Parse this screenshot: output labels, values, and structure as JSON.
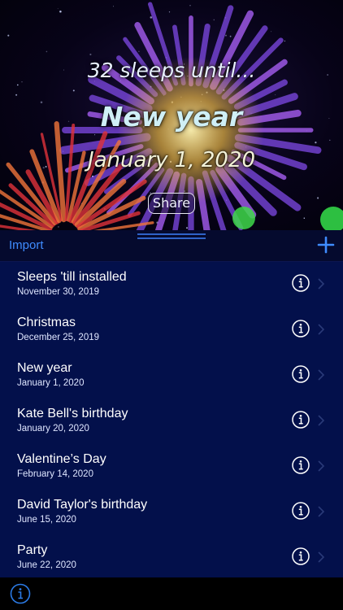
{
  "hero": {
    "countdown": "32 sleeps until...",
    "event_title": "New year",
    "event_date": "January 1, 2020",
    "share_label": "Share"
  },
  "toolbar": {
    "import_label": "Import",
    "add_icon": "plus-icon"
  },
  "events": [
    {
      "title": "Sleeps 'till installed",
      "date": "November 30, 2019"
    },
    {
      "title": "Christmas",
      "date": "December 25, 2019"
    },
    {
      "title": "New year",
      "date": "January 1, 2020"
    },
    {
      "title": "Kate Bell's birthday",
      "date": "January 20, 2020"
    },
    {
      "title": "Valentine’s Day",
      "date": "February 14, 2020"
    },
    {
      "title": "David Taylor's birthday",
      "date": "June 15, 2020"
    },
    {
      "title": "Party",
      "date": "June 22, 2020"
    }
  ],
  "bottom": {
    "info_icon": "info-icon"
  },
  "colors": {
    "accent": "#3f8cff",
    "list_background": "#03104b",
    "toolbar_background": "#050a2e"
  }
}
